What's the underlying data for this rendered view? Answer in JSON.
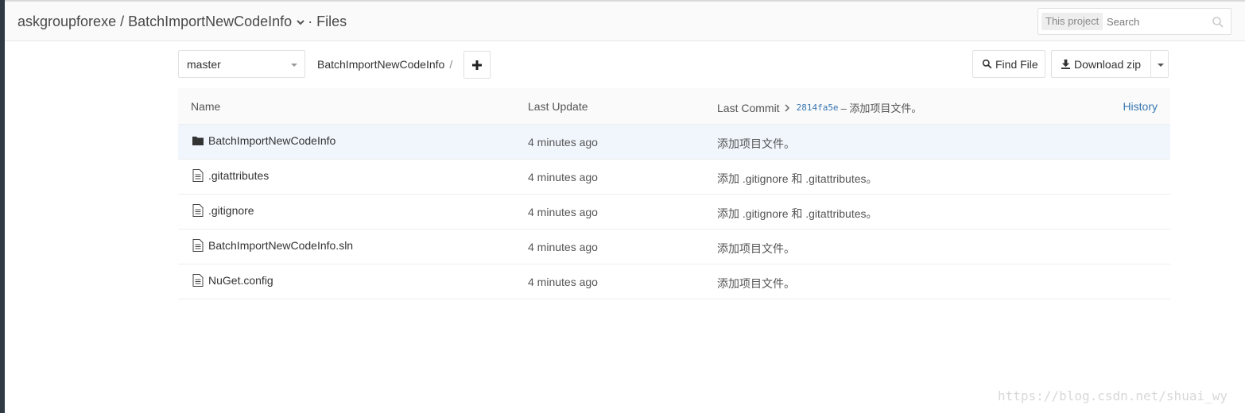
{
  "header": {
    "breadcrumb": "askgroupforexe / BatchImportNewCodeInfo",
    "section": "· Files",
    "search_scope": "This project",
    "search_placeholder": "Search"
  },
  "toolbar": {
    "branch": "master",
    "path": "BatchImportNewCodeInfo",
    "path_separator": "/",
    "find_file_label": "Find File",
    "download_label": "Download zip"
  },
  "table": {
    "columns": {
      "name": "Name",
      "last_update": "Last Update",
      "last_commit": "Last Commit",
      "commit_sha": "2814fa5e",
      "commit_msg": "– 添加项目文件。",
      "history": "History"
    },
    "rows": [
      {
        "icon": "folder-icon",
        "name": "BatchImportNewCodeInfo",
        "updated": "4 minutes ago",
        "commit": "添加项目文件。"
      },
      {
        "icon": "file-icon",
        "name": ".gitattributes",
        "updated": "4 minutes ago",
        "commit": "添加 .gitignore 和 .gitattributes。"
      },
      {
        "icon": "file-icon",
        "name": ".gitignore",
        "updated": "4 minutes ago",
        "commit": "添加 .gitignore 和 .gitattributes。"
      },
      {
        "icon": "file-icon",
        "name": "BatchImportNewCodeInfo.sln",
        "updated": "4 minutes ago",
        "commit": "添加项目文件。"
      },
      {
        "icon": "file-icon",
        "name": "NuGet.config",
        "updated": "4 minutes ago",
        "commit": "添加项目文件。"
      }
    ]
  },
  "watermark": "https://blog.csdn.net/shuai_wy",
  "colors": {
    "link": "#3777b0",
    "row_highlight": "#f1f6fd",
    "header_bg": "#fafafa"
  }
}
